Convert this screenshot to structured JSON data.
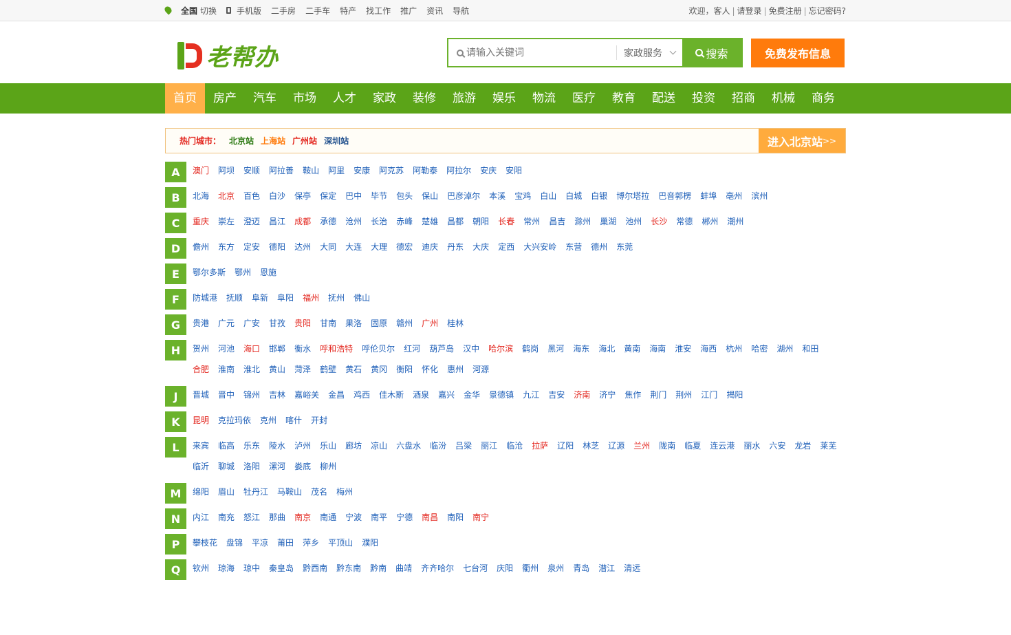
{
  "topbar": {
    "location": "全国",
    "switch": "切换",
    "mobile": "手机版",
    "links": [
      "二手房",
      "二手车",
      "特产",
      "找工作",
      "推广",
      "资讯",
      "导航"
    ],
    "welcome": "欢迎，客人",
    "login": "请登录",
    "register": "免费注册",
    "forgot": "忘记密码?"
  },
  "header": {
    "logo_text": "老帮办",
    "search_placeholder": "请输入关键词",
    "search_category": "家政服务",
    "search_button": "搜索",
    "publish_button": "免费发布信息"
  },
  "nav": [
    "首页",
    "房产",
    "汽车",
    "市场",
    "人才",
    "家政",
    "装修",
    "旅游",
    "娱乐",
    "物流",
    "医疗",
    "教育",
    "配送",
    "投资",
    "招商",
    "机械",
    "商务"
  ],
  "hot": {
    "label": "热门城市：",
    "cities": [
      {
        "name": "北京站",
        "color": "#2c7a12"
      },
      {
        "name": "上海站",
        "color": "#ff7b0c"
      },
      {
        "name": "广州站",
        "color": "#e3251d"
      },
      {
        "name": "深圳站",
        "color": "#1e4e8c"
      }
    ],
    "enter": "进入北京站",
    "enter_arrow": ">>"
  },
  "colors": {
    "green": "#5ba418",
    "orange": "#ff7b0c",
    "blue_link": "#1e5fb8",
    "red_link": "#e3251d"
  },
  "letters": [
    {
      "letter": "A",
      "cities": [
        [
          "澳门",
          1
        ],
        [
          "阿坝",
          0
        ],
        [
          "安顺",
          0
        ],
        [
          "阿拉善",
          0
        ],
        [
          "鞍山",
          0
        ],
        [
          "阿里",
          0
        ],
        [
          "安康",
          0
        ],
        [
          "阿克苏",
          0
        ],
        [
          "阿勒泰",
          0
        ],
        [
          "阿拉尔",
          0
        ],
        [
          "安庆",
          0
        ],
        [
          "安阳",
          0
        ]
      ]
    },
    {
      "letter": "B",
      "cities": [
        [
          "北海",
          0
        ],
        [
          "北京",
          1
        ],
        [
          "百色",
          0
        ],
        [
          "白沙",
          0
        ],
        [
          "保亭",
          0
        ],
        [
          "保定",
          0
        ],
        [
          "巴中",
          0
        ],
        [
          "毕节",
          0
        ],
        [
          "包头",
          0
        ],
        [
          "保山",
          0
        ],
        [
          "巴彦淖尔",
          0
        ],
        [
          "本溪",
          0
        ],
        [
          "宝鸡",
          0
        ],
        [
          "白山",
          0
        ],
        [
          "白城",
          0
        ],
        [
          "白银",
          0
        ],
        [
          "博尔塔拉",
          0
        ],
        [
          "巴音郭楞",
          0
        ],
        [
          "蚌埠",
          0
        ],
        [
          "亳州",
          0
        ],
        [
          "滨州",
          0
        ]
      ]
    },
    {
      "letter": "C",
      "cities": [
        [
          "重庆",
          1
        ],
        [
          "崇左",
          0
        ],
        [
          "澄迈",
          0
        ],
        [
          "昌江",
          0
        ],
        [
          "成都",
          1
        ],
        [
          "承德",
          0
        ],
        [
          "沧州",
          0
        ],
        [
          "长治",
          0
        ],
        [
          "赤峰",
          0
        ],
        [
          "楚雄",
          0
        ],
        [
          "昌都",
          0
        ],
        [
          "朝阳",
          0
        ],
        [
          "长春",
          1
        ],
        [
          "常州",
          0
        ],
        [
          "昌吉",
          0
        ],
        [
          "滁州",
          0
        ],
        [
          "巢湖",
          0
        ],
        [
          "池州",
          0
        ],
        [
          "长沙",
          1
        ],
        [
          "常德",
          0
        ],
        [
          "郴州",
          0
        ],
        [
          "潮州",
          0
        ]
      ]
    },
    {
      "letter": "D",
      "cities": [
        [
          "儋州",
          0
        ],
        [
          "东方",
          0
        ],
        [
          "定安",
          0
        ],
        [
          "德阳",
          0
        ],
        [
          "达州",
          0
        ],
        [
          "大同",
          0
        ],
        [
          "大连",
          0
        ],
        [
          "大理",
          0
        ],
        [
          "德宏",
          0
        ],
        [
          "迪庆",
          0
        ],
        [
          "丹东",
          0
        ],
        [
          "大庆",
          0
        ],
        [
          "定西",
          0
        ],
        [
          "大兴安岭",
          0
        ],
        [
          "东营",
          0
        ],
        [
          "德州",
          0
        ],
        [
          "东莞",
          0
        ]
      ]
    },
    {
      "letter": "E",
      "cities": [
        [
          "鄂尔多斯",
          0
        ],
        [
          "鄂州",
          0
        ],
        [
          "恩施",
          0
        ]
      ]
    },
    {
      "letter": "F",
      "cities": [
        [
          "防城港",
          0
        ],
        [
          "抚顺",
          0
        ],
        [
          "阜新",
          0
        ],
        [
          "阜阳",
          0
        ],
        [
          "福州",
          1
        ],
        [
          "抚州",
          0
        ],
        [
          "佛山",
          0
        ]
      ]
    },
    {
      "letter": "G",
      "cities": [
        [
          "贵港",
          0
        ],
        [
          "广元",
          0
        ],
        [
          "广安",
          0
        ],
        [
          "甘孜",
          0
        ],
        [
          "贵阳",
          1
        ],
        [
          "甘南",
          0
        ],
        [
          "果洛",
          0
        ],
        [
          "固原",
          0
        ],
        [
          "赣州",
          0
        ],
        [
          "广州",
          1
        ],
        [
          "桂林",
          0
        ]
      ]
    },
    {
      "letter": "H",
      "cities": [
        [
          "贺州",
          0
        ],
        [
          "河池",
          0
        ],
        [
          "海口",
          1
        ],
        [
          "邯郸",
          0
        ],
        [
          "衡水",
          0
        ],
        [
          "呼和浩特",
          1
        ],
        [
          "呼伦贝尔",
          0
        ],
        [
          "红河",
          0
        ],
        [
          "葫芦岛",
          0
        ],
        [
          "汉中",
          0
        ],
        [
          "哈尔滨",
          1
        ],
        [
          "鹤岗",
          0
        ],
        [
          "黑河",
          0
        ],
        [
          "海东",
          0
        ],
        [
          "海北",
          0
        ],
        [
          "黄南",
          0
        ],
        [
          "海南",
          0
        ],
        [
          "淮安",
          0
        ],
        [
          "海西",
          0
        ],
        [
          "杭州",
          0
        ],
        [
          "哈密",
          0
        ],
        [
          "湖州",
          0
        ],
        [
          "和田",
          0
        ],
        [
          "合肥",
          1
        ],
        [
          "淮南",
          0
        ],
        [
          "淮北",
          0
        ],
        [
          "黄山",
          0
        ],
        [
          "菏泽",
          0
        ],
        [
          "鹤壁",
          0
        ],
        [
          "黄石",
          0
        ],
        [
          "黄冈",
          0
        ],
        [
          "衡阳",
          0
        ],
        [
          "怀化",
          0
        ],
        [
          "惠州",
          0
        ],
        [
          "河源",
          0
        ]
      ]
    },
    {
      "letter": "J",
      "cities": [
        [
          "晋城",
          0
        ],
        [
          "晋中",
          0
        ],
        [
          "锦州",
          0
        ],
        [
          "吉林",
          0
        ],
        [
          "嘉峪关",
          0
        ],
        [
          "金昌",
          0
        ],
        [
          "鸡西",
          0
        ],
        [
          "佳木斯",
          0
        ],
        [
          "酒泉",
          0
        ],
        [
          "嘉兴",
          0
        ],
        [
          "金华",
          0
        ],
        [
          "景德镇",
          0
        ],
        [
          "九江",
          0
        ],
        [
          "吉安",
          0
        ],
        [
          "济南",
          1
        ],
        [
          "济宁",
          0
        ],
        [
          "焦作",
          0
        ],
        [
          "荆门",
          0
        ],
        [
          "荆州",
          0
        ],
        [
          "江门",
          0
        ],
        [
          "揭阳",
          0
        ]
      ]
    },
    {
      "letter": "K",
      "cities": [
        [
          "昆明",
          1
        ],
        [
          "克拉玛依",
          0
        ],
        [
          "克州",
          0
        ],
        [
          "喀什",
          0
        ],
        [
          "开封",
          0
        ]
      ]
    },
    {
      "letter": "L",
      "cities": [
        [
          "来宾",
          0
        ],
        [
          "临高",
          0
        ],
        [
          "乐东",
          0
        ],
        [
          "陵水",
          0
        ],
        [
          "泸州",
          0
        ],
        [
          "乐山",
          0
        ],
        [
          "廊坊",
          0
        ],
        [
          "凉山",
          0
        ],
        [
          "六盘水",
          0
        ],
        [
          "临汾",
          0
        ],
        [
          "吕梁",
          0
        ],
        [
          "丽江",
          0
        ],
        [
          "临沧",
          0
        ],
        [
          "拉萨",
          1
        ],
        [
          "辽阳",
          0
        ],
        [
          "林芝",
          0
        ],
        [
          "辽源",
          0
        ],
        [
          "兰州",
          1
        ],
        [
          "陇南",
          0
        ],
        [
          "临夏",
          0
        ],
        [
          "连云港",
          0
        ],
        [
          "丽水",
          0
        ],
        [
          "六安",
          0
        ],
        [
          "龙岩",
          0
        ],
        [
          "莱芜",
          0
        ],
        [
          "临沂",
          0
        ],
        [
          "聊城",
          0
        ],
        [
          "洛阳",
          0
        ],
        [
          "漯河",
          0
        ],
        [
          "娄底",
          0
        ],
        [
          "柳州",
          0
        ]
      ]
    },
    {
      "letter": "M",
      "cities": [
        [
          "绵阳",
          0
        ],
        [
          "眉山",
          0
        ],
        [
          "牡丹江",
          0
        ],
        [
          "马鞍山",
          0
        ],
        [
          "茂名",
          0
        ],
        [
          "梅州",
          0
        ]
      ]
    },
    {
      "letter": "N",
      "cities": [
        [
          "内江",
          0
        ],
        [
          "南充",
          0
        ],
        [
          "怒江",
          0
        ],
        [
          "那曲",
          0
        ],
        [
          "南京",
          1
        ],
        [
          "南通",
          0
        ],
        [
          "宁波",
          0
        ],
        [
          "南平",
          0
        ],
        [
          "宁德",
          0
        ],
        [
          "南昌",
          1
        ],
        [
          "南阳",
          0
        ],
        [
          "南宁",
          1
        ]
      ]
    },
    {
      "letter": "P",
      "cities": [
        [
          "攀枝花",
          0
        ],
        [
          "盘锦",
          0
        ],
        [
          "平凉",
          0
        ],
        [
          "莆田",
          0
        ],
        [
          "萍乡",
          0
        ],
        [
          "平顶山",
          0
        ],
        [
          "濮阳",
          0
        ]
      ]
    },
    {
      "letter": "Q",
      "cities": [
        [
          "钦州",
          0
        ],
        [
          "琼海",
          0
        ],
        [
          "琼中",
          0
        ],
        [
          "秦皇岛",
          0
        ],
        [
          "黔西南",
          0
        ],
        [
          "黔东南",
          0
        ],
        [
          "黔南",
          0
        ],
        [
          "曲靖",
          0
        ],
        [
          "齐齐哈尔",
          0
        ],
        [
          "七台河",
          0
        ],
        [
          "庆阳",
          0
        ],
        [
          "衢州",
          0
        ],
        [
          "泉州",
          0
        ],
        [
          "青岛",
          0
        ],
        [
          "潜江",
          0
        ],
        [
          "清远",
          0
        ]
      ]
    }
  ]
}
